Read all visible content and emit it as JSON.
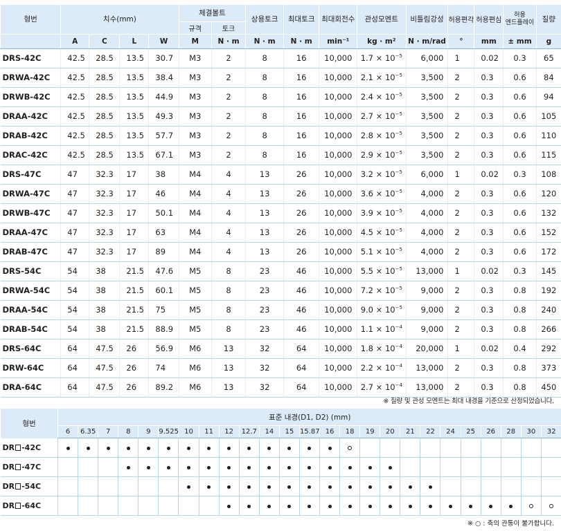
{
  "spec": {
    "headers": {
      "model": "형번",
      "dimensions": "치수(mm)",
      "bolt": "체결볼트",
      "bolt_size": "규격",
      "bolt_torque": "토크",
      "rated_torque": "상용토크",
      "max_torque": "최대토크",
      "max_rpm": "최대회전수",
      "inertia": "관성모멘트",
      "stiffness": "비틀림강성",
      "misalign": "허용편각",
      "offset": "허용편심",
      "endplay_1": "허용",
      "endplay_2": "엔드플레이",
      "mass": "질량"
    },
    "units": [
      "A",
      "C",
      "L",
      "W",
      "M",
      "N · m",
      "N · m",
      "N · m",
      "min⁻¹",
      "kg · m²",
      "N · m/rad",
      "°",
      "mm",
      "± mm",
      "g"
    ],
    "rows": [
      {
        "model": "DRS-42C",
        "A": "42.5",
        "C": "28.5",
        "L": "13.5",
        "W": "30.7",
        "M": "M3",
        "bt": "2",
        "rt": "8",
        "mt": "16",
        "rpm": "10,000",
        "inertia": "1.7 × 10",
        "exp": "−5",
        "stiff": "6,000",
        "ang": "1",
        "ecc": "0.02",
        "end": "0.3",
        "mass": "65"
      },
      {
        "model": "DRWA-42C",
        "A": "42.5",
        "C": "28.5",
        "L": "13.5",
        "W": "38.4",
        "M": "M3",
        "bt": "2",
        "rt": "8",
        "mt": "16",
        "rpm": "10,000",
        "inertia": "2.1 × 10",
        "exp": "−5",
        "stiff": "3,500",
        "ang": "2",
        "ecc": "0.3",
        "end": "0.6",
        "mass": "84"
      },
      {
        "model": "DRWB-42C",
        "A": "42.5",
        "C": "28.5",
        "L": "13.5",
        "W": "44.9",
        "M": "M3",
        "bt": "2",
        "rt": "8",
        "mt": "16",
        "rpm": "10,000",
        "inertia": "2.4 × 10",
        "exp": "−5",
        "stiff": "3,500",
        "ang": "2",
        "ecc": "0.3",
        "end": "0.6",
        "mass": "94"
      },
      {
        "model": "DRAA-42C",
        "A": "42.5",
        "C": "28.5",
        "L": "13.5",
        "W": "49.3",
        "M": "M3",
        "bt": "2",
        "rt": "8",
        "mt": "16",
        "rpm": "10,000",
        "inertia": "2.7 × 10",
        "exp": "−5",
        "stiff": "3,500",
        "ang": "2",
        "ecc": "0.3",
        "end": "0.6",
        "mass": "105"
      },
      {
        "model": "DRAB-42C",
        "A": "42.5",
        "C": "28.5",
        "L": "13.5",
        "W": "57.7",
        "M": "M3",
        "bt": "2",
        "rt": "8",
        "mt": "16",
        "rpm": "10,000",
        "inertia": "2.8 × 10",
        "exp": "−5",
        "stiff": "3,500",
        "ang": "2",
        "ecc": "0.3",
        "end": "0.6",
        "mass": "110"
      },
      {
        "model": "DRAC-42C",
        "A": "42.5",
        "C": "28.5",
        "L": "13.5",
        "W": "67.1",
        "M": "M3",
        "bt": "2",
        "rt": "8",
        "mt": "16",
        "rpm": "10,000",
        "inertia": "2.9 × 10",
        "exp": "−5",
        "stiff": "3,500",
        "ang": "2",
        "ecc": "0.3",
        "end": "0.6",
        "mass": "115"
      },
      {
        "model": "DRS-47C",
        "A": "47",
        "C": "32.3",
        "L": "17",
        "W": "38",
        "M": "M4",
        "bt": "4",
        "rt": "13",
        "mt": "26",
        "rpm": "10,000",
        "inertia": "3.2 × 10",
        "exp": "−5",
        "stiff": "6,000",
        "ang": "1",
        "ecc": "0.02",
        "end": "0.3",
        "mass": "108"
      },
      {
        "model": "DRWA-47C",
        "A": "47",
        "C": "32.3",
        "L": "17",
        "W": "46",
        "M": "M4",
        "bt": "4",
        "rt": "13",
        "mt": "26",
        "rpm": "10,000",
        "inertia": "3.6 × 10",
        "exp": "−5",
        "stiff": "4,000",
        "ang": "2",
        "ecc": "0.3",
        "end": "0.6",
        "mass": "120"
      },
      {
        "model": "DRWB-47C",
        "A": "47",
        "C": "32.3",
        "L": "17",
        "W": "50.1",
        "M": "M4",
        "bt": "4",
        "rt": "13",
        "mt": "26",
        "rpm": "10,000",
        "inertia": "3.9 × 10",
        "exp": "−5",
        "stiff": "4,000",
        "ang": "2",
        "ecc": "0.3",
        "end": "0.6",
        "mass": "132"
      },
      {
        "model": "DRAA-47C",
        "A": "47",
        "C": "32.3",
        "L": "17",
        "W": "63",
        "M": "M4",
        "bt": "4",
        "rt": "13",
        "mt": "26",
        "rpm": "10,000",
        "inertia": "4.5 × 10",
        "exp": "−5",
        "stiff": "4,000",
        "ang": "2",
        "ecc": "0.3",
        "end": "0.6",
        "mass": "152"
      },
      {
        "model": "DRAB-47C",
        "A": "47",
        "C": "32.3",
        "L": "17",
        "W": "89",
        "M": "M4",
        "bt": "4",
        "rt": "13",
        "mt": "26",
        "rpm": "10,000",
        "inertia": "5.1 × 10",
        "exp": "−5",
        "stiff": "4,000",
        "ang": "2",
        "ecc": "0.3",
        "end": "0.6",
        "mass": "172"
      },
      {
        "model": "DRS-54C",
        "A": "54",
        "C": "38",
        "L": "21.5",
        "W": "47.6",
        "M": "M5",
        "bt": "8",
        "rt": "23",
        "mt": "46",
        "rpm": "10,000",
        "inertia": "5.5 × 10",
        "exp": "−5",
        "stiff": "13,000",
        "ang": "1",
        "ecc": "0.02",
        "end": "0.3",
        "mass": "145"
      },
      {
        "model": "DRWA-54C",
        "A": "54",
        "C": "38",
        "L": "21.5",
        "W": "60.1",
        "M": "M5",
        "bt": "8",
        "rt": "23",
        "mt": "46",
        "rpm": "10,000",
        "inertia": "7.2 × 10",
        "exp": "−5",
        "stiff": "9,000",
        "ang": "2",
        "ecc": "0.3",
        "end": "0.8",
        "mass": "192"
      },
      {
        "model": "DRAA-54C",
        "A": "54",
        "C": "38",
        "L": "21.5",
        "W": "75",
        "M": "M5",
        "bt": "8",
        "rt": "23",
        "mt": "46",
        "rpm": "10,000",
        "inertia": "9.0 × 10",
        "exp": "−5",
        "stiff": "9,000",
        "ang": "2",
        "ecc": "0.3",
        "end": "0.8",
        "mass": "240"
      },
      {
        "model": "DRAB-54C",
        "A": "54",
        "C": "38",
        "L": "21.5",
        "W": "88.9",
        "M": "M5",
        "bt": "8",
        "rt": "23",
        "mt": "46",
        "rpm": "10,000",
        "inertia": "1.1 × 10",
        "exp": "−4",
        "stiff": "9,000",
        "ang": "2",
        "ecc": "0.3",
        "end": "0.8",
        "mass": "266"
      },
      {
        "model": "DRS-64C",
        "A": "64",
        "C": "47.5",
        "L": "26",
        "W": "56.9",
        "M": "M6",
        "bt": "13",
        "rt": "32",
        "mt": "64",
        "rpm": "10,000",
        "inertia": "1.8 × 10",
        "exp": "−4",
        "stiff": "20,000",
        "ang": "1",
        "ecc": "0.02",
        "end": "0.4",
        "mass": "292"
      },
      {
        "model": "DRW-64C",
        "A": "64",
        "C": "47.5",
        "L": "26",
        "W": "74",
        "M": "M6",
        "bt": "13",
        "rt": "32",
        "mt": "64",
        "rpm": "10,000",
        "inertia": "2.2 × 10",
        "exp": "−4",
        "stiff": "13,000",
        "ang": "2",
        "ecc": "0.3",
        "end": "0.8",
        "mass": "373"
      },
      {
        "model": "DRA-64C",
        "A": "64",
        "C": "47.5",
        "L": "26",
        "W": "89.2",
        "M": "M6",
        "bt": "13",
        "rt": "32",
        "mt": "64",
        "rpm": "10,000",
        "inertia": "2.7 × 10",
        "exp": "−4",
        "stiff": "13,000",
        "ang": "2",
        "ecc": "0.3",
        "end": "0.8",
        "mass": "450"
      }
    ],
    "note": "※ 질량 및 관성 모멘트는 최대 내경을 기준으로 산정되었습니다."
  },
  "bore": {
    "header_model": "형번",
    "header_caption": "표준 내경(D1, D2) (mm)",
    "diameters": [
      "6",
      "6.35",
      "7",
      "8",
      "9",
      "9.525",
      "10",
      "11",
      "12",
      "12.7",
      "14",
      "15",
      "15.875",
      "16",
      "18",
      "19",
      "20",
      "21",
      "22",
      "24",
      "25",
      "26",
      "28",
      "30",
      "32"
    ],
    "rows": [
      {
        "prefix": "DR",
        "suffix": "-42C",
        "marks": [
          "dot",
          "dot",
          "dot",
          "dot",
          "dot",
          "dot",
          "dot",
          "dot",
          "dot",
          "dot",
          "dot",
          "dot",
          "dot",
          "dot",
          "ring",
          "",
          "",
          "",
          "",
          "",
          "",
          "",
          "",
          "",
          ""
        ]
      },
      {
        "prefix": "DR",
        "suffix": "-47C",
        "marks": [
          "",
          "",
          "",
          "dot",
          "dot",
          "dot",
          "dot",
          "dot",
          "dot",
          "dot",
          "dot",
          "dot",
          "dot",
          "dot",
          "dot",
          "dot",
          "dot",
          "",
          "",
          "",
          "",
          "",
          "",
          "",
          ""
        ]
      },
      {
        "prefix": "DR",
        "suffix": "-54C",
        "marks": [
          "",
          "",
          "",
          "",
          "",
          "",
          "dot",
          "dot",
          "dot",
          "dot",
          "dot",
          "dot",
          "dot",
          "dot",
          "dot",
          "dot",
          "dot",
          "dot",
          "dot",
          "",
          "",
          "",
          "",
          "",
          ""
        ]
      },
      {
        "prefix": "DR",
        "suffix": "-64C",
        "marks": [
          "",
          "",
          "",
          "",
          "",
          "",
          "",
          "",
          "dot",
          "dot",
          "dot",
          "dot",
          "dot",
          "dot",
          "dot",
          "dot",
          "dot",
          "dot",
          "dot",
          "dot",
          "dot",
          "dot",
          "dot",
          "ring",
          "ring"
        ]
      }
    ],
    "note": "※ ○ : 축의 관통이 불가합니다."
  }
}
